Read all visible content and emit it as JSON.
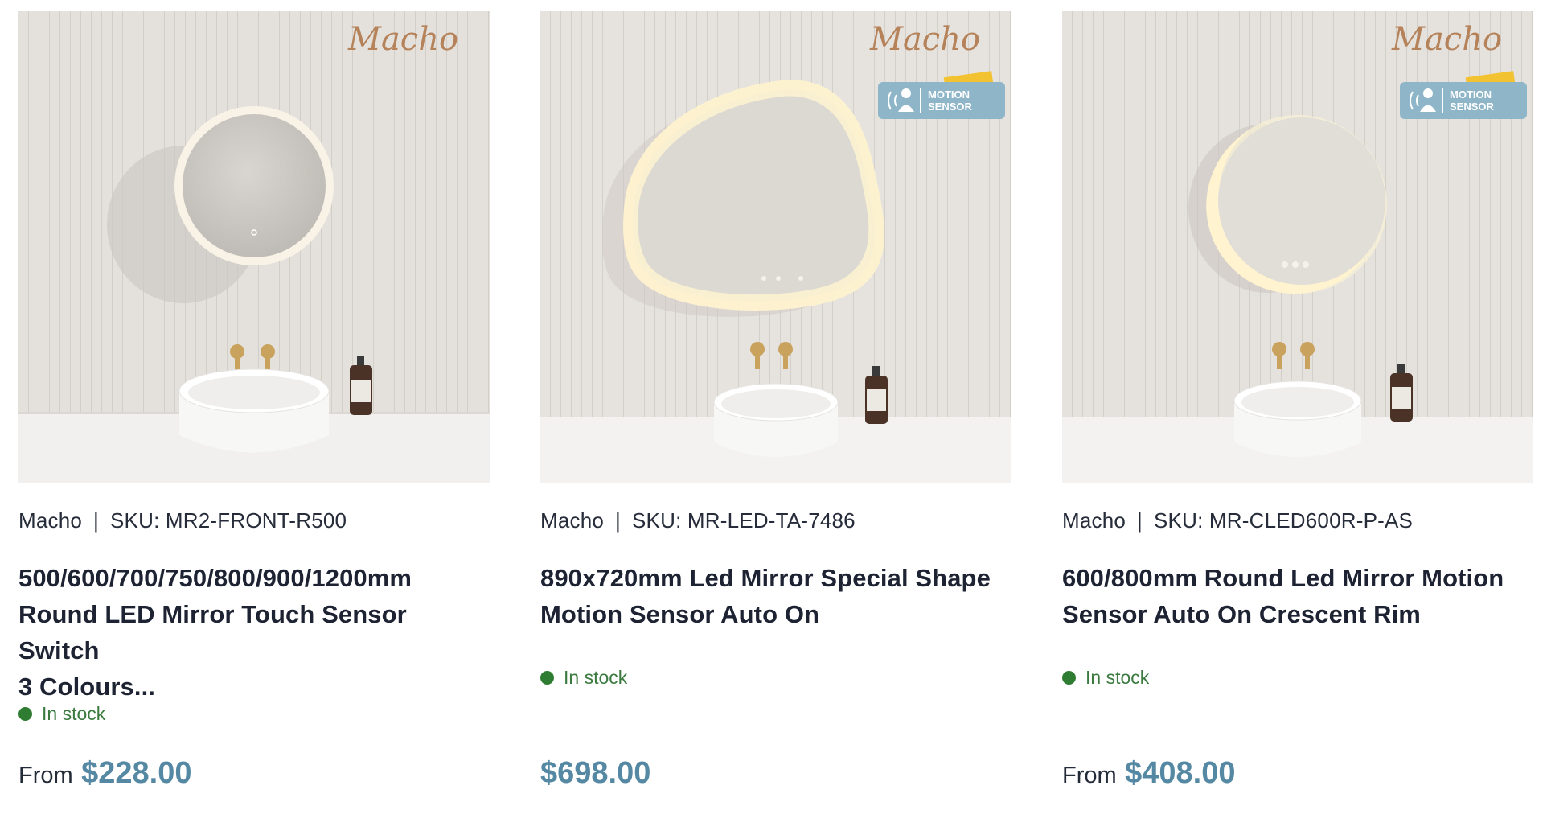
{
  "products": [
    {
      "brand": "Macho",
      "separator": "|",
      "sku": "SKU: MR2-FRONT-R500",
      "title_lines": [
        "500/600/700/750/800/900/1200mm",
        "Round LED Mirror Touch Sensor Switch",
        "3 Colours..."
      ],
      "stock": "In stock",
      "price_prefix": "From",
      "price": "$228.00",
      "watermark": "Macho",
      "mirror_shape": "round-front-lit",
      "badge": null
    },
    {
      "brand": "Macho",
      "separator": "|",
      "sku": "SKU: MR-LED-TA-7486",
      "title_lines": [
        "890x720mm Led Mirror Special Shape",
        "Motion Sensor Auto On"
      ],
      "stock": "In stock",
      "price_prefix": "",
      "price": "$698.00",
      "watermark": "Macho",
      "mirror_shape": "organic-back-lit",
      "badge": {
        "line1": "MOTION",
        "line2": "SENSOR"
      }
    },
    {
      "brand": "Macho",
      "separator": "|",
      "sku": "SKU: MR-CLED600R-P-AS",
      "title_lines": [
        "600/800mm Round Led Mirror Motion",
        "Sensor Auto On Crescent Rim"
      ],
      "stock": "In stock",
      "price_prefix": "From",
      "price": "$408.00",
      "watermark": "Macho",
      "mirror_shape": "round-crescent-rim",
      "badge": {
        "line1": "MOTION",
        "line2": "SENSOR"
      }
    }
  ],
  "colors": {
    "stock_green": "#2f7d32",
    "price_blue": "#5588a3",
    "badge_blue": "#8fb6c8",
    "badge_yellow": "#f2c230",
    "watermark_brown": "#b5825a"
  },
  "icons": {
    "stock": "stock-dot-icon",
    "badge": "motion-sensor-icon"
  }
}
